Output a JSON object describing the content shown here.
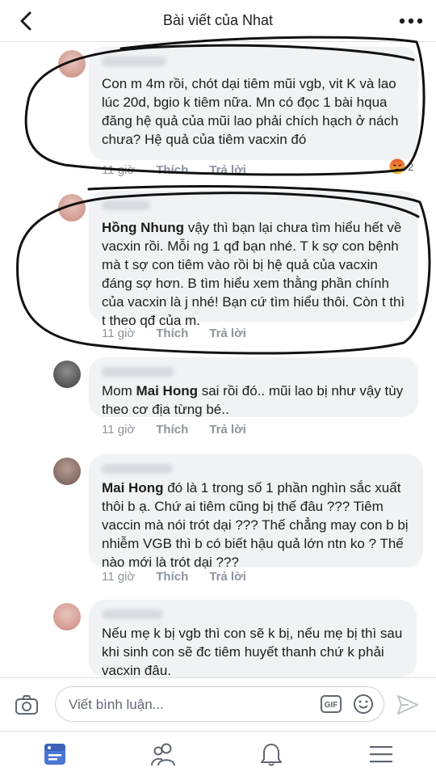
{
  "header": {
    "title": "Bài viết của Nhat",
    "back_icon": "chevron-left-icon",
    "more_icon": "more-horizontal-icon"
  },
  "comments": [
    {
      "name_blurred": true,
      "mention": "",
      "text": "Con m 4m rồi, chót dại tiêm mũi vgb, vit K và lao lúc 20d, bgio k tiêm nữa. Mn có đọc 1 bài hqua đăng hệ quả của mũi lao phải chích hạch ở nách chưa? Hệ quả của tiêm vacxin đó",
      "time": "11 giờ",
      "like": "Thích",
      "reply": "Trả lời",
      "reaction_count": "2",
      "reaction_icon": "angry-icon"
    },
    {
      "name_blurred": true,
      "mention": "Hồng Nhung",
      "text": " vậy thì bạn lại chưa tìm hiểu hết về vacxin rồi. Mỗi ng 1 qđ bạn nhé. T k sợ con bệnh mà t sợ con tiêm vào rồi bị hệ quả của vacxin đáng sợ hơn. B tìm hiểu xem thằng phần chính của vacxin là j nhé! Bạn cứ tìm hiểu thôi. Còn t thì t theo qđ của m.",
      "time": "11 giờ",
      "like": "Thích",
      "reply": "Trả lời"
    },
    {
      "name_blurred": true,
      "prefix": "Mom ",
      "mention": "Mai Hong",
      "text": " sai rồi đó.. mũi lao bị như vậy tùy theo cơ địa từng bé..",
      "time": "11 giờ",
      "like": "Thích",
      "reply": "Trả lời"
    },
    {
      "name_blurred": true,
      "mention": "Mai Hong",
      "text": " đó là 1 trong số 1 phần nghìn sắc xuất thôi b ạ. Chứ ai tiêm cũng bị thế đâu ??? Tiêm vaccin mà nói trót dại ??? Thế chẳng may con b bị nhiễm VGB thì b có biết hậu quả lớn ntn ko ? Thế nào mới là trót dại ???",
      "time": "11 giờ",
      "like": "Thích",
      "reply": "Trả lời"
    },
    {
      "name_blurred": true,
      "mention": "",
      "text": "Nếu mẹ k bị vgb thì con sẽ k bị, nếu mẹ bị thì sau khi sinh con sẽ đc tiêm huyết thanh chứ k phải vacxin đâu."
    }
  ],
  "composer": {
    "placeholder": "Viết bình luận...",
    "gif_label": "GIF"
  },
  "bottom_nav": [
    "feed-icon",
    "friends-icon",
    "notifications-icon",
    "menu-icon"
  ],
  "colors": {
    "accent": "#4a76d4",
    "bubble": "#f1f2f4",
    "meta": "#8d949e",
    "ink": "#111111"
  }
}
